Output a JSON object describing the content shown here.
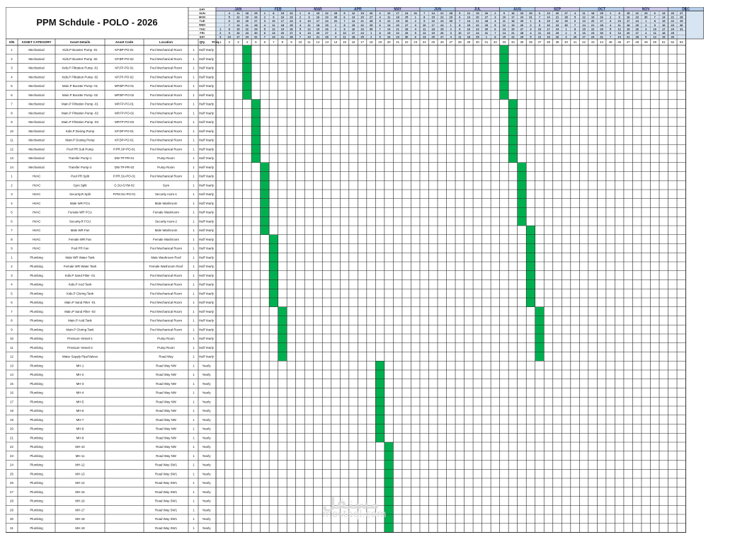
{
  "title": "PPM Schdule - POLO - 2026",
  "headers": {
    "sn": "S/N",
    "category": "ASSET CATEGORY",
    "details": "Asset Details",
    "code": "Asset Code",
    "location": "Location",
    "qty": "Qty",
    "freq": "Freq."
  },
  "day_labels": [
    "DAY",
    "SUN",
    "MON",
    "TUE",
    "WED",
    "THU",
    "FRI",
    "SAT"
  ],
  "months": [
    "JAN",
    "FEB",
    "MAR",
    "APR",
    "MAY",
    "JUN",
    "JUL",
    "AUG",
    "SEP",
    "OCT",
    "NOV",
    "DEC"
  ],
  "weeks_per_month": [
    5,
    4,
    5,
    4,
    5,
    4,
    5,
    4,
    5,
    5,
    5,
    4
  ],
  "week_numbers": [
    "1",
    "2",
    "3",
    "4",
    "5",
    "6",
    "7",
    "8",
    "9",
    "10",
    "11",
    "12",
    "13",
    "14",
    "15",
    "16",
    "17",
    "18",
    "19",
    "20",
    "21",
    "22",
    "23",
    "24",
    "25",
    "26",
    "27",
    "28",
    "29",
    "30",
    "31",
    "32",
    "33",
    "34",
    "35",
    "36",
    "37",
    "38",
    "39",
    "40",
    "41",
    "42",
    "43",
    "44",
    "45",
    "46",
    "47",
    "48",
    "49",
    "50",
    "51",
    "52",
    "53"
  ],
  "colors": {
    "month_fill": "#c9c7e6",
    "month_alt": "#b6cde8",
    "date_fill": "#d7e4f2",
    "sunday_text": "#d00000",
    "schedule_fill": "#00b050",
    "grid": "#222222"
  },
  "rows": [
    {
      "sn": "1",
      "category": "Mechanical",
      "details": "Kids.P Booster Pump -01",
      "code": "KP.BP-PO-01",
      "location": "Pool Mechanical Room",
      "qty": "1",
      "freq": "Half Yearly",
      "weeks": [
        4,
        33
      ]
    },
    {
      "sn": "2",
      "category": "Mechanical",
      "details": "Kids.P Booster Pump -02",
      "code": "KP.BP-PO-02",
      "location": "Pool Mechanical Room",
      "qty": "1",
      "freq": "Half Yearly",
      "weeks": [
        4,
        33
      ]
    },
    {
      "sn": "3",
      "category": "Mechanical",
      "details": "Kids.P Filtration Pump -01",
      "code": "KP.FP-PO-01",
      "location": "Pool Mechanical Room",
      "qty": "1",
      "freq": "Half Yearly",
      "weeks": [
        4,
        33
      ]
    },
    {
      "sn": "4",
      "category": "Mechanical",
      "details": "Kids.P Filtration Pump -02",
      "code": "KP.FP-PO-02",
      "location": "Pool Mechanical Room",
      "qty": "1",
      "freq": "Half Yearly",
      "weeks": [
        4,
        33
      ]
    },
    {
      "sn": "5",
      "category": "Mechanical",
      "details": "Main.P Booster Pump -01",
      "code": "MP.BP-PO-01",
      "location": "Pool Mechanical Room",
      "qty": "1",
      "freq": "Half Yearly",
      "weeks": [
        4,
        33
      ]
    },
    {
      "sn": "6",
      "category": "Mechanical",
      "details": "Main.P Booster Pump -02",
      "code": "MP.BP-PO-02",
      "location": "Pool Mechanical Room",
      "qty": "1",
      "freq": "Half Yearly",
      "weeks": [
        4,
        33
      ]
    },
    {
      "sn": "7",
      "category": "Mechanical",
      "details": "Main.P Filtration Pump -01",
      "code": "MP.FP-PO-01",
      "location": "Pool Mechanical Room",
      "qty": "1",
      "freq": "Half Yearly",
      "weeks": [
        5,
        34
      ]
    },
    {
      "sn": "8",
      "category": "Mechanical",
      "details": "Main.P Filtration Pump -02",
      "code": "MP.FP-PO-02",
      "location": "Pool Mechanical Room",
      "qty": "1",
      "freq": "Half Yearly",
      "weeks": [
        5,
        34
      ]
    },
    {
      "sn": "9",
      "category": "Mechanical",
      "details": "Main.P Filtration Pump -03",
      "code": "MP.FP-PO-03",
      "location": "Pool Mechanical Room",
      "qty": "1",
      "freq": "Half Yearly",
      "weeks": [
        5,
        34
      ]
    },
    {
      "sn": "10",
      "category": "Mechanical",
      "details": "Kids.P Dosing Pump",
      "code": "KP.DP-PO-01",
      "location": "Pool Mechanical Room",
      "qty": "1",
      "freq": "Half Yearly",
      "weeks": [
        5,
        34
      ]
    },
    {
      "sn": "11",
      "category": "Mechanical",
      "details": "Main.P Dosing Pump",
      "code": "KP.DP-PO-01",
      "location": "Pool Mechanical Room",
      "qty": "1",
      "freq": "Half Yearly",
      "weeks": [
        5,
        34
      ]
    },
    {
      "sn": "12",
      "category": "Mechanical",
      "details": "Pool PR Sub Pump",
      "code": "P.PR.SP-PO-01",
      "location": "Pool Mechanical Room",
      "qty": "1",
      "freq": "Half Yearly",
      "weeks": [
        5,
        34
      ]
    },
    {
      "sn": "13",
      "category": "Mechanical",
      "details": "Transfer Pump-1",
      "code": "DW.TP-PR-01",
      "location": "Pump Room",
      "qty": "1",
      "freq": "Half Yearly",
      "weeks": [
        5,
        34
      ]
    },
    {
      "sn": "14",
      "category": "Mechanical",
      "details": "Transfer Pump-2",
      "code": "DW.TP-PR-02",
      "location": "Pump Room",
      "qty": "1",
      "freq": "Half Yearly",
      "weeks": [
        6,
        35
      ]
    },
    {
      "sn": "1",
      "category": "HVAC",
      "details": "Pool PR Split",
      "code": "P.PR.SU-PO-01",
      "location": "Pool Mechanical Room",
      "qty": "1",
      "freq": "Half Yearly",
      "weeks": [
        6,
        35
      ]
    },
    {
      "sn": "2",
      "category": "HVAC",
      "details": "Gym Split",
      "code": "G.SU-GYM-02",
      "location": "Gym",
      "qty": "1",
      "freq": "Half Yearly",
      "weeks": [
        6,
        35
      ]
    },
    {
      "sn": "3",
      "category": "HVAC",
      "details": "Security.R Split",
      "code": "P.PM.SU-PO-01",
      "location": "Security room-1",
      "qty": "1",
      "freq": "Half Yearly",
      "weeks": [
        6,
        35
      ]
    },
    {
      "sn": "4",
      "category": "HVAC",
      "details": "Male WR FCU",
      "code": "",
      "location": "Male Washroom",
      "qty": "1",
      "freq": "Half Yearly",
      "weeks": [
        6,
        35
      ]
    },
    {
      "sn": "5",
      "category": "HVAC",
      "details": "Female WR FCU",
      "code": "",
      "location": "Female Washroom",
      "qty": "1",
      "freq": "Half Yearly",
      "weeks": [
        6,
        35
      ]
    },
    {
      "sn": "6",
      "category": "HVAC",
      "details": "Security.R FCU",
      "code": "",
      "location": "Security room-2",
      "qty": "1",
      "freq": "Half Yearly",
      "weeks": [
        6,
        35
      ]
    },
    {
      "sn": "7",
      "category": "HVAC",
      "details": "Male WR Fan",
      "code": "",
      "location": "Male Washroom",
      "qty": "1",
      "freq": "Half Yearly",
      "weeks": [
        6,
        36
      ]
    },
    {
      "sn": "8",
      "category": "HVAC",
      "details": "Female WR Fan",
      "code": "",
      "location": "Female Washroom",
      "qty": "1",
      "freq": "Half Yearly",
      "weeks": [
        7,
        36
      ]
    },
    {
      "sn": "9",
      "category": "HVAC",
      "details": "Pool PR Fan",
      "code": "",
      "location": "Pool Mechanical Room",
      "qty": "1",
      "freq": "Half Yearly",
      "weeks": [
        7,
        36
      ]
    },
    {
      "sn": "1",
      "category": "Plumbing",
      "details": "Male WR Water Tank",
      "code": "",
      "location": "Male Washroom Roof",
      "qty": "1",
      "freq": "Half Yearly",
      "weeks": [
        7,
        36
      ]
    },
    {
      "sn": "2",
      "category": "Plumbing",
      "details": "Female WR Water Tank",
      "code": "",
      "location": "Female Washroom Roof",
      "qty": "1",
      "freq": "Half Yearly",
      "weeks": [
        7,
        36
      ]
    },
    {
      "sn": "3",
      "category": "Plumbing",
      "details": "Kids.P Sand Filter -01",
      "code": "",
      "location": "Pool Mechanical Room",
      "qty": "1",
      "freq": "Half Yearly",
      "weeks": [
        7,
        36
      ]
    },
    {
      "sn": "4",
      "category": "Plumbing",
      "details": "Kids.P Acid Tank",
      "code": "",
      "location": "Pool Mechanical Room",
      "qty": "1",
      "freq": "Half Yearly",
      "weeks": [
        7,
        36
      ]
    },
    {
      "sn": "5",
      "category": "Plumbing",
      "details": "Kids.P Cloring Tank",
      "code": "",
      "location": "Pool Mechanical Room",
      "qty": "1",
      "freq": "Half Yearly",
      "weeks": [
        7,
        36
      ]
    },
    {
      "sn": "6",
      "category": "Plumbing",
      "details": "Main.P Sand Filter -01",
      "code": "",
      "location": "Pool Mechanical Room",
      "qty": "1",
      "freq": "Half Yearly",
      "weeks": [
        7,
        36
      ]
    },
    {
      "sn": "7",
      "category": "Plumbing",
      "details": "Main.P Sand Filter -02",
      "code": "",
      "location": "Pool Mechanical Room",
      "qty": "1",
      "freq": "Half Yearly",
      "weeks": [
        8,
        37
      ]
    },
    {
      "sn": "8",
      "category": "Plumbing",
      "details": "Main.P Acid Tank",
      "code": "",
      "location": "Pool Mechanical Room",
      "qty": "1",
      "freq": "Half Yearly",
      "weeks": [
        8,
        37
      ]
    },
    {
      "sn": "9",
      "category": "Plumbing",
      "details": "Main.P Cloring Tank",
      "code": "",
      "location": "Pool Mechanical Room",
      "qty": "1",
      "freq": "Half Yearly",
      "weeks": [
        8,
        37
      ]
    },
    {
      "sn": "10",
      "category": "Plumbing",
      "details": "Pressure Vessel-1",
      "code": "",
      "location": "Pump Room",
      "qty": "1",
      "freq": "Half Yearly",
      "weeks": [
        8,
        37
      ]
    },
    {
      "sn": "11",
      "category": "Plumbing",
      "details": "Pressure Vessel-2",
      "code": "",
      "location": "Pump Room",
      "qty": "1",
      "freq": "Half Yearly",
      "weeks": [
        8,
        37
      ]
    },
    {
      "sn": "12",
      "category": "Plumbing",
      "details": "Water Supply Pipe/Valves",
      "code": "",
      "location": "Road Way",
      "qty": "1",
      "freq": "Half Yearly",
      "weeks": [
        8,
        37
      ]
    },
    {
      "sn": "13",
      "category": "Plumbing",
      "details": "MH-1",
      "code": "",
      "location": "Road Way NW",
      "qty": "1",
      "freq": "Yearly",
      "weeks": [
        19
      ]
    },
    {
      "sn": "14",
      "category": "Plumbing",
      "details": "MH-2",
      "code": "",
      "location": "Road Way NW",
      "qty": "1",
      "freq": "Yearly",
      "weeks": [
        19
      ]
    },
    {
      "sn": "15",
      "category": "Plumbing",
      "details": "MH-3",
      "code": "",
      "location": "Road Way NW",
      "qty": "1",
      "freq": "Yearly",
      "weeks": [
        19
      ]
    },
    {
      "sn": "16",
      "category": "Plumbing",
      "details": "MH-4",
      "code": "",
      "location": "Road Way NW",
      "qty": "1",
      "freq": "Yearly",
      "weeks": [
        19
      ]
    },
    {
      "sn": "17",
      "category": "Plumbing",
      "details": "MH-5",
      "code": "",
      "location": "Road Way NW",
      "qty": "1",
      "freq": "Yearly",
      "weeks": [
        19
      ]
    },
    {
      "sn": "18",
      "category": "Plumbing",
      "details": "MH-6",
      "code": "",
      "location": "Road Way NW",
      "qty": "1",
      "freq": "Yearly",
      "weeks": [
        19
      ]
    },
    {
      "sn": "19",
      "category": "Plumbing",
      "details": "MH-7",
      "code": "",
      "location": "Road Way NW",
      "qty": "1",
      "freq": "Yearly",
      "weeks": [
        19
      ]
    },
    {
      "sn": "20",
      "category": "Plumbing",
      "details": "MH-8",
      "code": "",
      "location": "Road Way NW",
      "qty": "1",
      "freq": "Yearly",
      "weeks": [
        19
      ]
    },
    {
      "sn": "21",
      "category": "Plumbing",
      "details": "MH-9",
      "code": "",
      "location": "Road Way NW",
      "qty": "1",
      "freq": "Yearly",
      "weeks": [
        19
      ]
    },
    {
      "sn": "22",
      "category": "Plumbing",
      "details": "MH-10",
      "code": "",
      "location": "Road Way NW",
      "qty": "1",
      "freq": "Yearly",
      "weeks": [
        20
      ]
    },
    {
      "sn": "23",
      "category": "Plumbing",
      "details": "MH-11",
      "code": "",
      "location": "Road Way NW",
      "qty": "1",
      "freq": "Yearly",
      "weeks": [
        20
      ]
    },
    {
      "sn": "24",
      "category": "Plumbing",
      "details": "MH-12",
      "code": "",
      "location": "Road Way SW1",
      "qty": "1",
      "freq": "Yearly",
      "weeks": [
        20
      ]
    },
    {
      "sn": "25",
      "category": "Plumbing",
      "details": "MH-13",
      "code": "",
      "location": "Road Way SW1",
      "qty": "1",
      "freq": "Yearly",
      "weeks": [
        20
      ]
    },
    {
      "sn": "26",
      "category": "Plumbing",
      "details": "MH-14",
      "code": "",
      "location": "Road Way SW1",
      "qty": "1",
      "freq": "Yearly",
      "weeks": [
        20
      ]
    },
    {
      "sn": "27",
      "category": "Plumbing",
      "details": "MH-15",
      "code": "",
      "location": "Road Way SW1",
      "qty": "1",
      "freq": "Yearly",
      "weeks": [
        20
      ]
    },
    {
      "sn": "28",
      "category": "Plumbing",
      "details": "MH-16",
      "code": "",
      "location": "Road Way SW1",
      "qty": "1",
      "freq": "Yearly",
      "weeks": [
        20
      ]
    },
    {
      "sn": "29",
      "category": "Plumbing",
      "details": "MH-17",
      "code": "",
      "location": "Road Way SW1",
      "qty": "1",
      "freq": "Yearly",
      "weeks": [
        20
      ]
    },
    {
      "sn": "30",
      "category": "Plumbing",
      "details": "MH-18",
      "code": "",
      "location": "Road Way SW1",
      "qty": "1",
      "freq": "Yearly",
      "weeks": [
        20
      ]
    },
    {
      "sn": "31",
      "category": "Plumbing",
      "details": "MH-19",
      "code": "",
      "location": "Road Way SW1",
      "qty": "1",
      "freq": "Yearly",
      "weeks": [
        20
      ]
    }
  ],
  "watermark": {
    "line1": "ﻣﺴﺘﻘﻞ",
    "line2": "mostaql.com"
  }
}
